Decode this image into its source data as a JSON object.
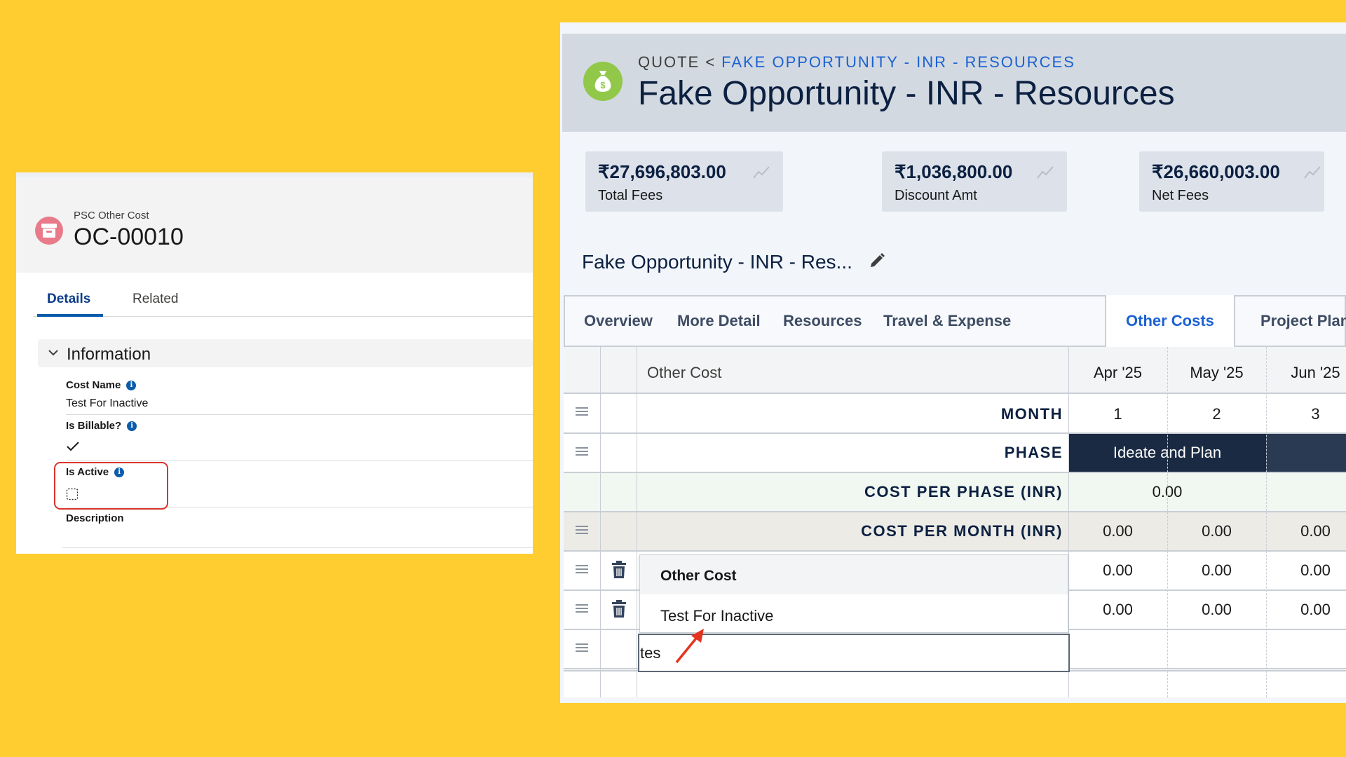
{
  "left": {
    "object_label": "PSC Other Cost",
    "record_title": "OC-00010",
    "tabs": [
      {
        "label": "Details"
      },
      {
        "label": "Related"
      }
    ],
    "section_title": "Information",
    "fields": {
      "cost_name": {
        "label": "Cost Name",
        "value": "Test For Inactive"
      },
      "is_billable": {
        "label": "Is Billable?",
        "checked": true
      },
      "is_active": {
        "label": "Is Active",
        "checked": false
      },
      "description": {
        "label": "Description",
        "value": ""
      }
    },
    "info_glyph": "i"
  },
  "right": {
    "breadcrumb": {
      "object": "QUOTE",
      "separator": "<",
      "link": "FAKE OPPORTUNITY - INR - RESOURCES"
    },
    "title": "Fake Opportunity - INR - Resources",
    "kpis": [
      {
        "value": "₹27,696,803.00",
        "label": "Total Fees"
      },
      {
        "value": "₹1,036,800.00",
        "label": "Discount Amt"
      },
      {
        "value": "₹26,660,003.00",
        "label": "Net Fees"
      }
    ],
    "record_title": "Fake Opportunity - INR - Res...",
    "tabs": [
      {
        "label": "Overview"
      },
      {
        "label": "More Detail"
      },
      {
        "label": "Resources"
      },
      {
        "label": "Travel & Expense"
      },
      {
        "label": "Other Costs"
      },
      {
        "label": "Project Plan"
      }
    ],
    "active_tab": "Other Costs",
    "grid": {
      "header": {
        "label": "Other Cost",
        "months": [
          "Apr '25",
          "May '25",
          "Jun '25"
        ]
      },
      "month_row": {
        "label": "MONTH",
        "values": [
          "1",
          "2",
          "3"
        ]
      },
      "phase_row": {
        "label": "PHASE",
        "phase": "Ideate and Plan"
      },
      "cost_per_phase": {
        "label": "COST PER PHASE (INR)",
        "value": "0.00"
      },
      "cost_per_month": {
        "label": "COST PER MONTH (INR)",
        "values": [
          "0.00",
          "0.00",
          "0.00"
        ]
      },
      "rows": [
        {
          "values": [
            "0.00",
            "0.00",
            "0.00"
          ]
        },
        {
          "values": [
            "0.00",
            "0.00",
            "0.00"
          ]
        }
      ]
    },
    "dropdown": {
      "header": "Other Cost",
      "option": "Test For Inactive"
    },
    "input_value": "tes"
  },
  "colors": {
    "background": "#FFCD30",
    "accent_blue": "#1b61d1",
    "phase_dark": "#1a2a42",
    "highlight_red": "#d9342b",
    "quote_icon": "#91c84a",
    "cost_icon": "#e97a8a"
  }
}
